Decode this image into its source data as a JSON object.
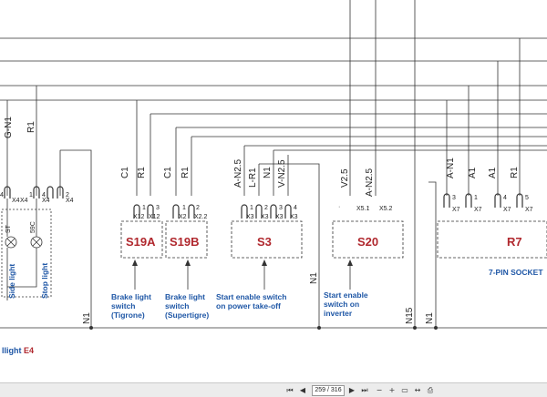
{
  "wires_top": {
    "g_n1": "G-N1",
    "r1": "R1"
  },
  "e4_group": {
    "pins": [
      {
        "num": "4",
        "conn": "X4"
      },
      {
        "num": "1",
        "conn": "X4"
      },
      {
        "num": "4",
        "conn": "X4"
      },
      {
        "num": "2",
        "conn": "X4"
      }
    ],
    "lamp1_label": "ST",
    "lamp2_label": "59C",
    "side_light": "Side light",
    "stop_light": "Stop light",
    "bottom_prefix": "llight",
    "bottom_code": "E4"
  },
  "s19a": {
    "name": "S19A",
    "wires": [
      "C1",
      "R1"
    ],
    "pins": [
      {
        "num": "1",
        "conn": "X12"
      },
      {
        "num": "3",
        "conn": "X12"
      }
    ],
    "desc": [
      "Brake light",
      "switch",
      "(Tigrone)"
    ]
  },
  "s19b": {
    "name": "S19B",
    "wires": [
      "C1",
      "R1"
    ],
    "pins": [
      {
        "num": "1",
        "conn": "X2"
      },
      {
        "num": "2",
        "conn": "X2.2"
      }
    ],
    "desc": [
      "Brake light",
      "switch",
      "(Supertigre)"
    ]
  },
  "s3": {
    "name": "S3",
    "wires": [
      "A-N2.5",
      "L-R1",
      "N1",
      "V-N2.5"
    ],
    "pins": [
      {
        "num": "1",
        "conn": "X3"
      },
      {
        "num": "2",
        "conn": "X3"
      },
      {
        "num": "3",
        "conn": "X3"
      },
      {
        "num": "4",
        "conn": "X3"
      }
    ],
    "desc": [
      "Start enable switch",
      "on power take-off"
    ]
  },
  "s20": {
    "name": "S20",
    "wires": [
      "V2.5",
      "A-N2.5"
    ],
    "pins": [
      {
        "dot": "·",
        "conn": "X5.1"
      },
      {
        "dot": "·",
        "conn": "X5.2"
      }
    ],
    "desc": [
      "Start enable",
      "switch on",
      "inverter"
    ]
  },
  "r7": {
    "name": "R7",
    "wires": [
      "A-N1",
      "A1",
      "A1",
      "R1"
    ],
    "pins": [
      {
        "num": "3",
        "conn": "X7"
      },
      {
        "num": "1",
        "conn": "X7"
      },
      {
        "num": "4",
        "conn": "X7"
      },
      {
        "num": "5",
        "conn": "X7"
      }
    ],
    "desc": "7-PIN SOCKET"
  },
  "ground_labels": {
    "n1_left": "N1",
    "n1_mid": "N1",
    "n15": "N15",
    "n1_right": "N1"
  },
  "viewer": {
    "page_text": "259 / 316",
    "first_icon": "first-page-icon",
    "prev_icon": "prev-page-icon",
    "next_icon": "next-page-icon",
    "last_icon": "last-page-icon",
    "zoom_icons": [
      "zoom-out-icon",
      "zoom-in-icon",
      "fit-page-icon",
      "fit-width-icon",
      "print-icon"
    ]
  }
}
